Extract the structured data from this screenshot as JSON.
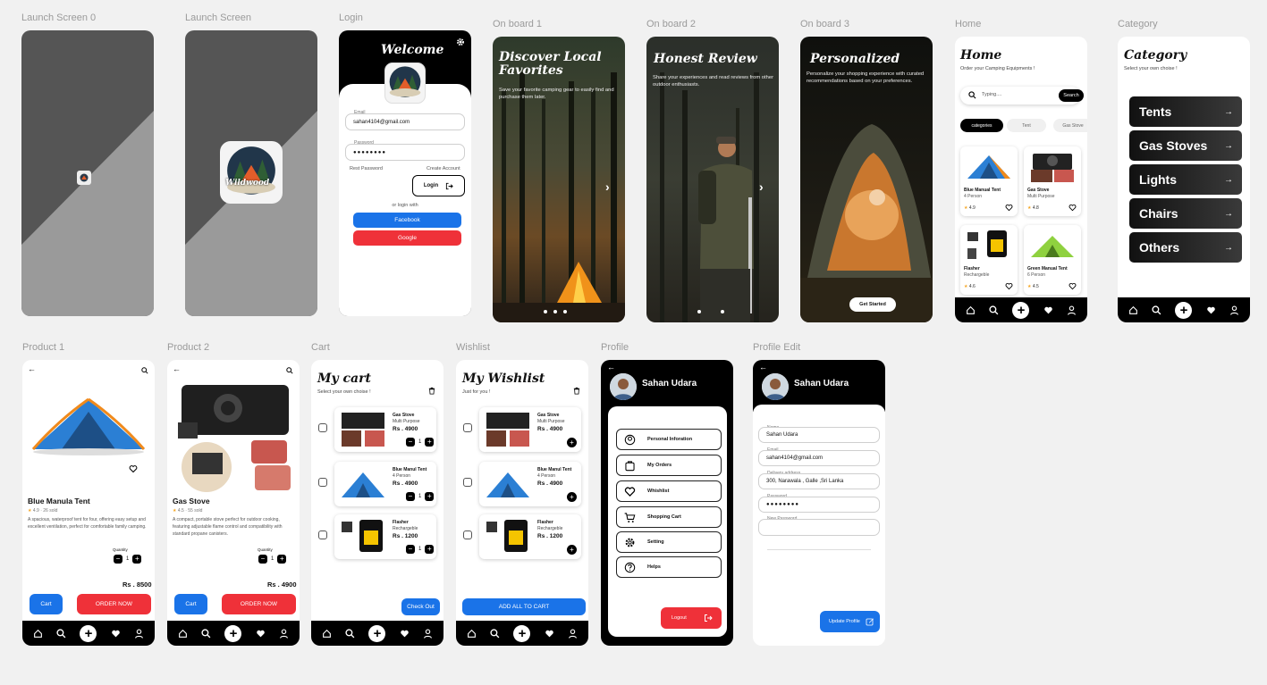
{
  "labels": {
    "launch0": "Launch Screen 0",
    "launch": "Launch Screen",
    "login": "Login",
    "onboard1": "On board 1",
    "onboard2": "On board 2",
    "onboard3": "On board 3",
    "home": "Home",
    "category": "Category",
    "product1": "Product 1",
    "product2": "Product 2",
    "cart": "Cart",
    "wishlist": "Wishlist",
    "profile": "Profile",
    "profile_edit": "Profile Edit"
  },
  "logo_text": "Wildwood",
  "login": {
    "title": "Welcome",
    "email_label": "Email",
    "email_value": "sahan4104@gmail.com",
    "password_label": "Password",
    "password_value": "●●●●●●●●",
    "reset": "Rest Password",
    "create": "Create Account",
    "login_btn": "Login",
    "or": "or login with",
    "facebook": "Facebook",
    "google": "Google"
  },
  "onboard": [
    {
      "title": "Discover Local Favorites",
      "text": "Save your favorite camping gear to easily find and purchase them later."
    },
    {
      "title": "Honest Review",
      "text": "Share your experiences and read reviews from other outdoor enthusiasts."
    },
    {
      "title": "Personalized",
      "text": "Personalize your shopping experience with curated recommendations based on your preferences.",
      "button": "Get Started"
    }
  ],
  "home": {
    "title": "Home",
    "subtitle": "Order your Camping Equipments !",
    "search_placeholder": "Typing....",
    "search_btn": "Search",
    "chips": [
      "categories",
      "Tent",
      "Gas Stove"
    ],
    "products": [
      {
        "name": "Blue Manual Tent",
        "sub": "4 Person",
        "rating": "4.9"
      },
      {
        "name": "Gas Stove",
        "sub": "Multi Purpose",
        "rating": "4.8"
      },
      {
        "name": "Flasher",
        "sub": "Rechargeble",
        "rating": "4.6"
      },
      {
        "name": "Green Manual Tent",
        "sub": "6 Person",
        "rating": "4.5"
      }
    ]
  },
  "category": {
    "title": "Category",
    "subtitle": "Select your own choise !",
    "items": [
      "Tents",
      "Gas Stoves",
      "Lights",
      "Chairs",
      "Others"
    ]
  },
  "product1": {
    "name": "Blue Manula Tent",
    "rating": "4.9",
    "sold": "26 sold",
    "desc": "A spacious, waterproof tent for four, offering easy setup and excellent ventilation, perfect for comfortable family camping.",
    "qty_label": "Quantity",
    "qty": "1",
    "price": "Rs . 8500",
    "cart_btn": "Cart",
    "order_btn": "ORDER NOW"
  },
  "product2": {
    "name": "Gas Stove",
    "rating": "4.5",
    "sold": "55 sold",
    "desc": "A compact, portable stove perfect for outdoor cooking, featuring adjustable flame control and compatibility with standard propane canisters.",
    "qty_label": "Quantity",
    "qty": "1",
    "price": "Rs . 4900",
    "cart_btn": "Cart",
    "order_btn": "ORDER NOW"
  },
  "cart": {
    "title": "My cart",
    "subtitle": "Select your own choise !",
    "items": [
      {
        "name": "Gas Stove",
        "sub": "Multi Purpose",
        "price": "Rs . 4900",
        "qty": "1"
      },
      {
        "name": "Blue Manul Tent",
        "sub": "4 Person",
        "price": "Rs . 4900",
        "qty": "1"
      },
      {
        "name": "Flasher",
        "sub": "Rechargeble",
        "price": "Rs . 1200",
        "qty": "1"
      }
    ],
    "checkout": "Check Out"
  },
  "wishlist": {
    "title": "My Wishlist",
    "subtitle": "Just for you !",
    "items": [
      {
        "name": "Gas Stove",
        "sub": "Multi Purpose",
        "price": "Rs . 4900"
      },
      {
        "name": "Blue Manul Tent",
        "sub": "4 Person",
        "price": "Rs . 4900"
      },
      {
        "name": "Flasher",
        "sub": "Rechargeble",
        "price": "Rs . 1200"
      }
    ],
    "add_all": "ADD ALL TO CART"
  },
  "profile": {
    "name": "Sahan Udara",
    "menu": [
      "Personal Inforation",
      "My Orders",
      "Whishlist",
      "Shopping Cart",
      "Setting",
      "Helps"
    ],
    "logout": "Logout"
  },
  "profile_edit": {
    "name": "Sahan Udara",
    "name_label": "Name",
    "name_value": "Sahan Udara",
    "email_label": "Email",
    "email_value": "sahan4104@gmail.com",
    "address_label": "Delivery address",
    "address_value": "300, Narawala , Galle ,Sri Lanka",
    "password_label": "Password",
    "password_value": "●●●●●●●●",
    "new_password_label": "New Password",
    "update_btn": "Update Profile"
  },
  "colors": {
    "blue": "#1a73e8",
    "red": "#ef3139",
    "black": "#000000"
  }
}
